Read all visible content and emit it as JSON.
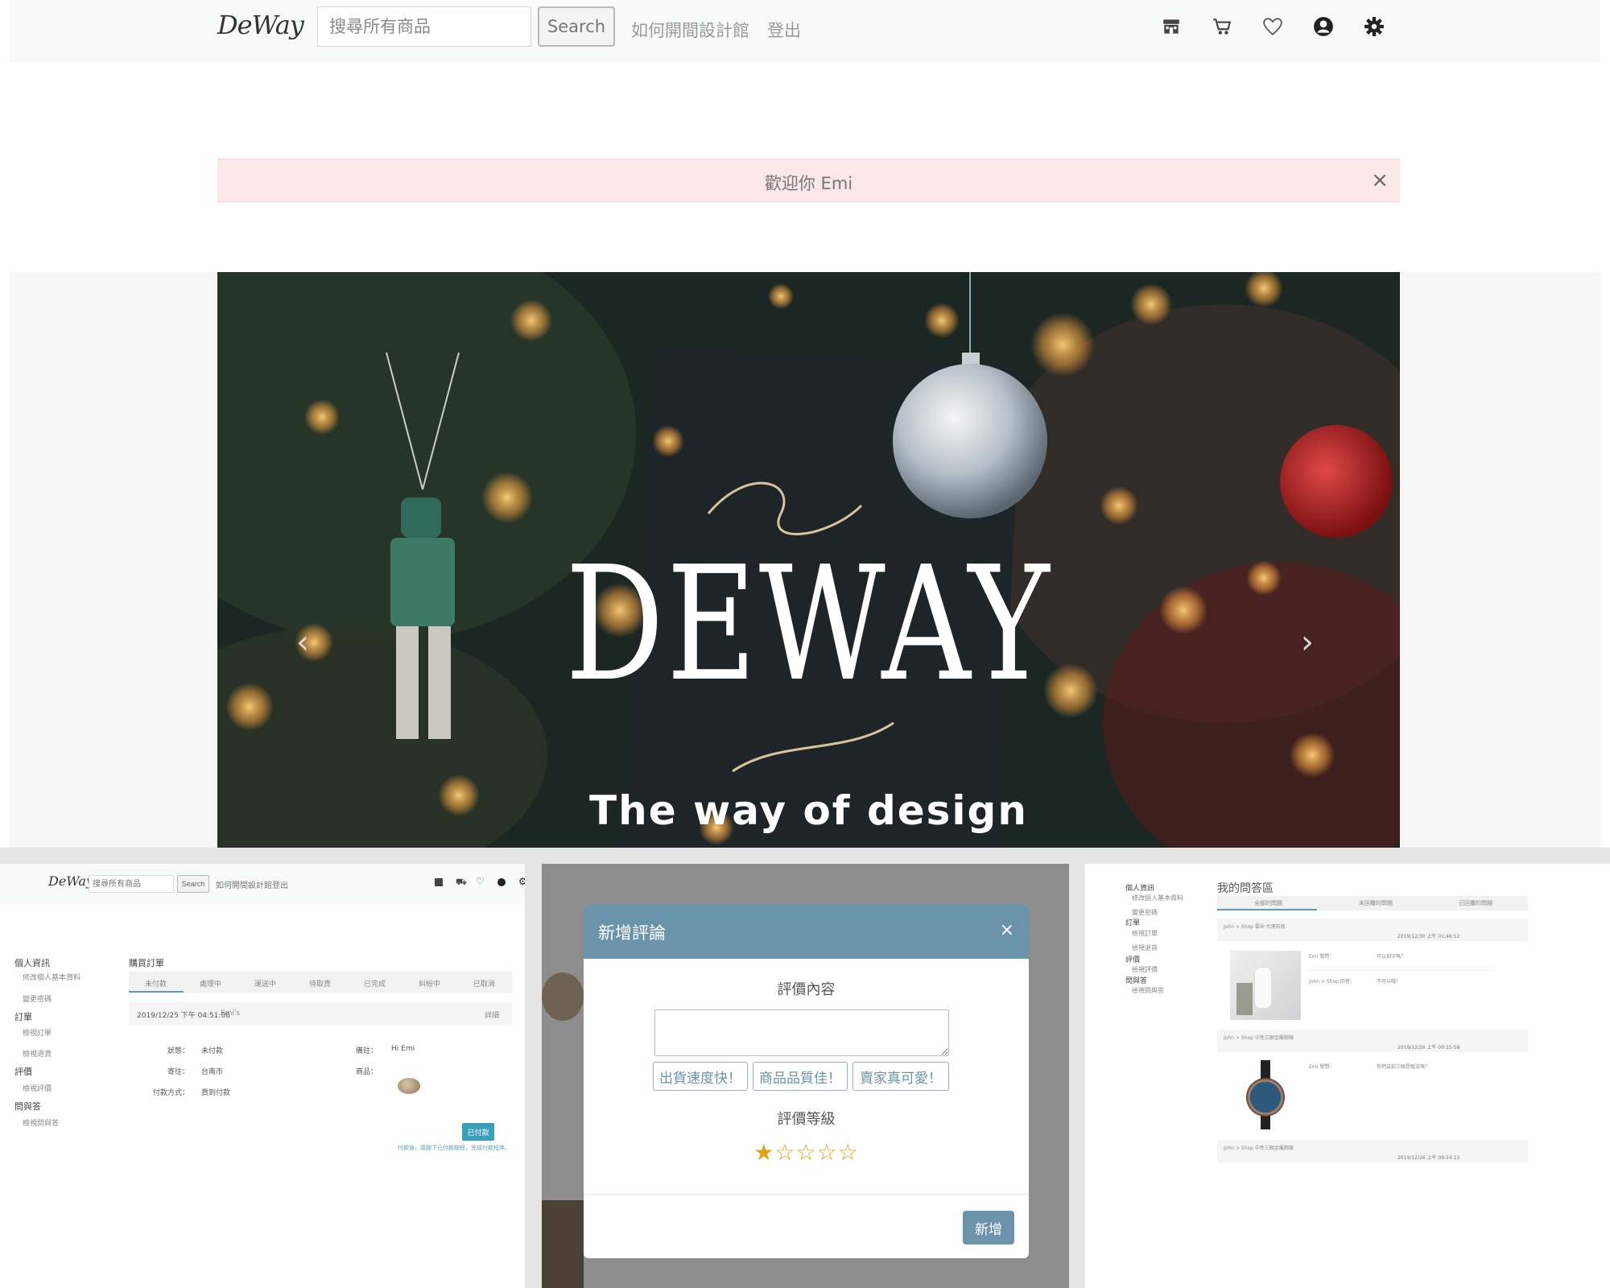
{
  "brand": {
    "logo": "DeWay"
  },
  "navbar": {
    "search_placeholder": "搜尋所有商品",
    "search_button": "Search",
    "links": [
      "如何開間設計館",
      "登出"
    ],
    "icons": [
      "store-icon",
      "cart-icon",
      "heart-icon",
      "user-icon",
      "gear-icon"
    ]
  },
  "alert": {
    "text": "歡迎你 Emi",
    "close": "×"
  },
  "hero": {
    "title": "DEWAY",
    "subtitle": "The way of design",
    "prev": "‹",
    "next": "›"
  },
  "panel_orders": {
    "nav": {
      "logo": "DeWay",
      "search_placeholder": "搜尋所有商品",
      "search_button": "Search",
      "links": [
        "如何開間設計館",
        "登出"
      ]
    },
    "sidebar": [
      {
        "label": "個人資訊",
        "type": "heading"
      },
      {
        "label": "修改個人基本資料",
        "type": "item"
      },
      {
        "label": "變更密碼",
        "type": "item"
      },
      {
        "label": "訂單",
        "type": "heading"
      },
      {
        "label": "檢視訂單",
        "type": "item"
      },
      {
        "label": "檢視退貨",
        "type": "item"
      },
      {
        "label": "評價",
        "type": "heading"
      },
      {
        "label": "檢視評價",
        "type": "item"
      },
      {
        "label": "問與答",
        "type": "heading"
      },
      {
        "label": "檢視問與答",
        "type": "item"
      }
    ],
    "section_title": "購買訂單",
    "tabs": [
      "未付款",
      "處理中",
      "運送中",
      "待取貨",
      "已完成",
      "糾紛中",
      "已取消"
    ],
    "order": {
      "datetime": "2019/12/25 下午 04:51:08",
      "shop": "Emi's",
      "detail_link": "詳細",
      "fields": [
        {
          "label": "狀態：",
          "value": "未付款"
        },
        {
          "label": "寄往：",
          "value": "台南市"
        },
        {
          "label": "付款方式：",
          "value": "貨到付款"
        }
      ],
      "note_label": "備註：",
      "note_value": "Hi Emi",
      "product_label": "商品：",
      "pay_button": "已付款",
      "hint": "付款後，請按下已付款按鈕，完成付款程序。"
    }
  },
  "panel_review": {
    "title": "新增評論",
    "close": "×",
    "content_label": "評價內容",
    "quick_buttons": [
      "出貨速度快！",
      "商品品質佳！",
      "賣家真可愛！"
    ],
    "rating_label": "評價等級",
    "rating": {
      "value": 1,
      "max": 5
    },
    "submit": "新增"
  },
  "panel_qa": {
    "sidebar": [
      {
        "label": "個人資訊",
        "type": "heading"
      },
      {
        "label": "修改個人基本資料",
        "type": "item"
      },
      {
        "label": "變更密碼",
        "type": "item"
      },
      {
        "label": "訂單",
        "type": "heading"
      },
      {
        "label": "檢視訂單",
        "type": "item"
      },
      {
        "label": "檢視退貨",
        "type": "item"
      },
      {
        "label": "評價",
        "type": "heading"
      },
      {
        "label": "檢視評價",
        "type": "item"
      },
      {
        "label": "問與答",
        "type": "heading"
      },
      {
        "label": "檢視問與答",
        "type": "item"
      }
    ],
    "title": "我的問答區",
    "tabs": [
      "全部的問題",
      "未回覆的問題",
      "已回覆的問題"
    ],
    "cards": [
      {
        "header": "John > Shop 雲朵·大理石瓶",
        "datetime": "2019/12/30 上午 01:46:52",
        "messages": [
          {
            "who": "Emi 發問：",
            "text": "可以刻字嗎？"
          },
          {
            "who": "John > Shop 回答：",
            "text": "不可以哦！"
          }
        ]
      },
      {
        "header": "John > Shop 中性三眼金屬腕錶",
        "datetime": "2019/12/26 上午 09:15:58",
        "messages": [
          {
            "who": "Emi 發問：",
            "text": "你們這款三眼是贈送嗎？"
          }
        ]
      },
      {
        "header": "John > Shop 中性三眼金屬腕錶",
        "datetime": "2019/12/26 上午 09:14:23",
        "messages": []
      }
    ]
  }
}
